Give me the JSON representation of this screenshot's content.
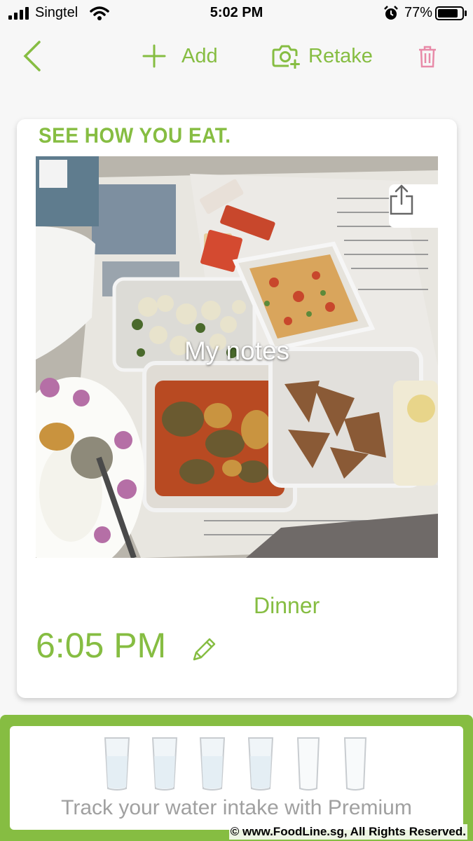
{
  "status_bar": {
    "carrier": "Singtel",
    "time": "5:02 PM",
    "battery_percent": "77%",
    "icons": [
      "signal-icon",
      "wifi-icon",
      "alarm-icon",
      "battery-icon"
    ]
  },
  "toolbar": {
    "back_icon": "chevron-left-icon",
    "add_label": "Add",
    "retake_label": "Retake",
    "trash_icon": "trash-icon"
  },
  "card": {
    "tagline": "SEE HOW YOU EAT.",
    "photo_caption": "My notes",
    "share_icon": "share-icon",
    "meal_type": "Dinner",
    "meal_time": "6:05 PM",
    "edit_icon": "pencil-icon"
  },
  "water": {
    "glasses_count": 6,
    "message": "Track your water intake with Premium"
  },
  "watermark": "© www.FoodLine.sg, All Rights Reserved.",
  "colors": {
    "accent_green": "#86bd42",
    "trash_pink": "#e88aa8",
    "hint_gray": "#a0a0a0"
  }
}
